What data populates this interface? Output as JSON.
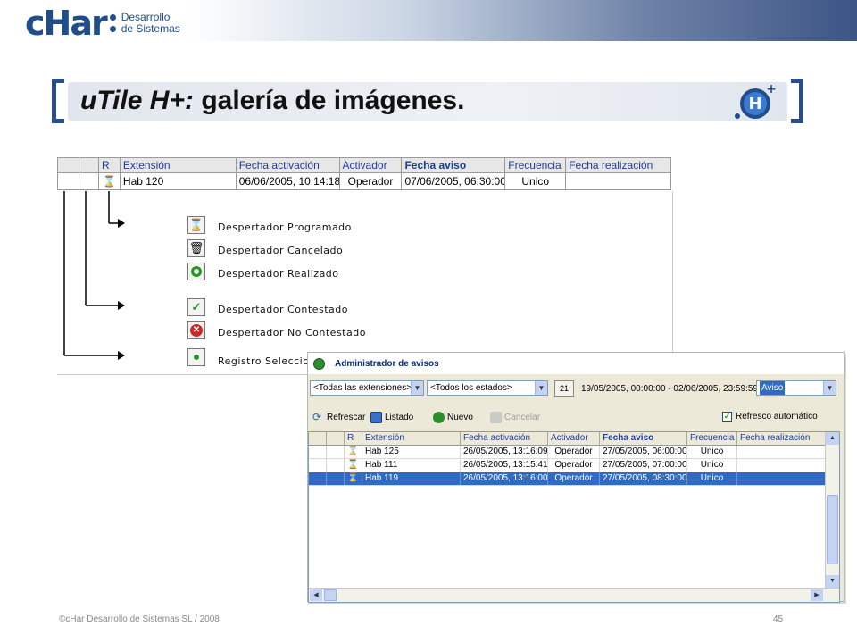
{
  "brand": {
    "mark": "cHar",
    "line1": "Desarrollo",
    "line2": "de Sistemas"
  },
  "slide": {
    "title_italic": "uTile H+:",
    "title_rest": " galería de imágenes."
  },
  "diagram_grid": {
    "headers": [
      "",
      "",
      "R",
      "Extensión",
      "Fecha activación",
      "Activador",
      "Fecha aviso",
      "Frecuencia",
      "Fecha realización"
    ],
    "row": [
      "",
      "",
      "⌛",
      "Hab 120",
      "06/06/2005, 10:14:18",
      "Operador",
      "07/06/2005, 06:30:00",
      "Unico",
      ""
    ]
  },
  "legend": [
    {
      "label": "Despertador Programado",
      "icon": "hourglass-icon"
    },
    {
      "label": "Despertador Cancelado",
      "icon": "trash-icon"
    },
    {
      "label": "Despertador Realizado",
      "icon": "circle-icon"
    },
    {
      "label": "Despertador Contestado",
      "icon": "check-icon"
    },
    {
      "label": "Despertador No Contestado",
      "icon": "cross-icon"
    },
    {
      "label": "Registro Seleccionado",
      "icon": "dot-icon"
    }
  ],
  "window": {
    "title": "Administrador de avisos",
    "ext_filter": "<Todas las extensiones>",
    "state_filter": "<Todos los estados>",
    "date_range": "19/05/2005, 00:00:00 - 02/06/2005, 23:59:59",
    "type_filter": "Aviso",
    "calendar_label": "21",
    "tools": {
      "refresh": "Refrescar",
      "list": "Listado",
      "new": "Nuevo",
      "cancel": "Cancelar"
    },
    "auto_refresh": "Refresco automático",
    "grid": {
      "headers": [
        "",
        "",
        "R",
        "Extensión",
        "Fecha activación",
        "Activador",
        "Fecha aviso",
        "Frecuencia",
        "Fecha realización"
      ],
      "rows": [
        [
          "",
          "",
          "⌛",
          "Hab 125",
          "26/05/2005, 13:16:09",
          "Operador",
          "27/05/2005, 06:00:00",
          "Unico",
          ""
        ],
        [
          "",
          "",
          "⌛",
          "Hab 111",
          "26/05/2005, 13:15:41",
          "Operador",
          "27/05/2005, 07:00:00",
          "Unico",
          ""
        ],
        [
          "",
          "",
          "⌛",
          "Hab 119",
          "26/05/2005, 13:16:00",
          "Operador",
          "27/05/2005, 08:30:00",
          "Unico",
          ""
        ]
      ]
    }
  },
  "footer": {
    "copyright": "©cHar Desarrollo de Sistemas SL / 2008",
    "page": "45"
  }
}
